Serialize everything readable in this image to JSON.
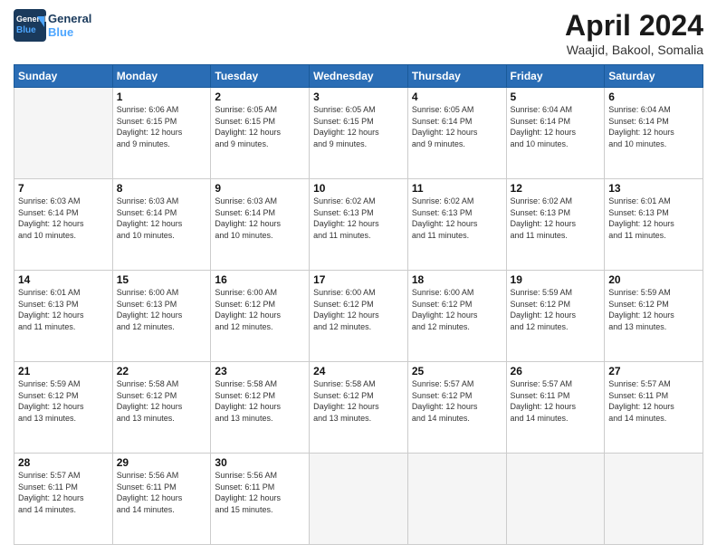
{
  "header": {
    "logo_line1": "General",
    "logo_line2": "Blue",
    "month_title": "April 2024",
    "location": "Waajid, Bakool, Somalia"
  },
  "weekdays": [
    "Sunday",
    "Monday",
    "Tuesday",
    "Wednesday",
    "Thursday",
    "Friday",
    "Saturday"
  ],
  "weeks": [
    [
      {
        "day": "",
        "info": ""
      },
      {
        "day": "1",
        "info": "Sunrise: 6:06 AM\nSunset: 6:15 PM\nDaylight: 12 hours\nand 9 minutes."
      },
      {
        "day": "2",
        "info": "Sunrise: 6:05 AM\nSunset: 6:15 PM\nDaylight: 12 hours\nand 9 minutes."
      },
      {
        "day": "3",
        "info": "Sunrise: 6:05 AM\nSunset: 6:15 PM\nDaylight: 12 hours\nand 9 minutes."
      },
      {
        "day": "4",
        "info": "Sunrise: 6:05 AM\nSunset: 6:14 PM\nDaylight: 12 hours\nand 9 minutes."
      },
      {
        "day": "5",
        "info": "Sunrise: 6:04 AM\nSunset: 6:14 PM\nDaylight: 12 hours\nand 10 minutes."
      },
      {
        "day": "6",
        "info": "Sunrise: 6:04 AM\nSunset: 6:14 PM\nDaylight: 12 hours\nand 10 minutes."
      }
    ],
    [
      {
        "day": "7",
        "info": "Sunrise: 6:03 AM\nSunset: 6:14 PM\nDaylight: 12 hours\nand 10 minutes."
      },
      {
        "day": "8",
        "info": "Sunrise: 6:03 AM\nSunset: 6:14 PM\nDaylight: 12 hours\nand 10 minutes."
      },
      {
        "day": "9",
        "info": "Sunrise: 6:03 AM\nSunset: 6:14 PM\nDaylight: 12 hours\nand 10 minutes."
      },
      {
        "day": "10",
        "info": "Sunrise: 6:02 AM\nSunset: 6:13 PM\nDaylight: 12 hours\nand 11 minutes."
      },
      {
        "day": "11",
        "info": "Sunrise: 6:02 AM\nSunset: 6:13 PM\nDaylight: 12 hours\nand 11 minutes."
      },
      {
        "day": "12",
        "info": "Sunrise: 6:02 AM\nSunset: 6:13 PM\nDaylight: 12 hours\nand 11 minutes."
      },
      {
        "day": "13",
        "info": "Sunrise: 6:01 AM\nSunset: 6:13 PM\nDaylight: 12 hours\nand 11 minutes."
      }
    ],
    [
      {
        "day": "14",
        "info": "Sunrise: 6:01 AM\nSunset: 6:13 PM\nDaylight: 12 hours\nand 11 minutes."
      },
      {
        "day": "15",
        "info": "Sunrise: 6:00 AM\nSunset: 6:13 PM\nDaylight: 12 hours\nand 12 minutes."
      },
      {
        "day": "16",
        "info": "Sunrise: 6:00 AM\nSunset: 6:12 PM\nDaylight: 12 hours\nand 12 minutes."
      },
      {
        "day": "17",
        "info": "Sunrise: 6:00 AM\nSunset: 6:12 PM\nDaylight: 12 hours\nand 12 minutes."
      },
      {
        "day": "18",
        "info": "Sunrise: 6:00 AM\nSunset: 6:12 PM\nDaylight: 12 hours\nand 12 minutes."
      },
      {
        "day": "19",
        "info": "Sunrise: 5:59 AM\nSunset: 6:12 PM\nDaylight: 12 hours\nand 12 minutes."
      },
      {
        "day": "20",
        "info": "Sunrise: 5:59 AM\nSunset: 6:12 PM\nDaylight: 12 hours\nand 13 minutes."
      }
    ],
    [
      {
        "day": "21",
        "info": "Sunrise: 5:59 AM\nSunset: 6:12 PM\nDaylight: 12 hours\nand 13 minutes."
      },
      {
        "day": "22",
        "info": "Sunrise: 5:58 AM\nSunset: 6:12 PM\nDaylight: 12 hours\nand 13 minutes."
      },
      {
        "day": "23",
        "info": "Sunrise: 5:58 AM\nSunset: 6:12 PM\nDaylight: 12 hours\nand 13 minutes."
      },
      {
        "day": "24",
        "info": "Sunrise: 5:58 AM\nSunset: 6:12 PM\nDaylight: 12 hours\nand 13 minutes."
      },
      {
        "day": "25",
        "info": "Sunrise: 5:57 AM\nSunset: 6:12 PM\nDaylight: 12 hours\nand 14 minutes."
      },
      {
        "day": "26",
        "info": "Sunrise: 5:57 AM\nSunset: 6:11 PM\nDaylight: 12 hours\nand 14 minutes."
      },
      {
        "day": "27",
        "info": "Sunrise: 5:57 AM\nSunset: 6:11 PM\nDaylight: 12 hours\nand 14 minutes."
      }
    ],
    [
      {
        "day": "28",
        "info": "Sunrise: 5:57 AM\nSunset: 6:11 PM\nDaylight: 12 hours\nand 14 minutes."
      },
      {
        "day": "29",
        "info": "Sunrise: 5:56 AM\nSunset: 6:11 PM\nDaylight: 12 hours\nand 14 minutes."
      },
      {
        "day": "30",
        "info": "Sunrise: 5:56 AM\nSunset: 6:11 PM\nDaylight: 12 hours\nand 15 minutes."
      },
      {
        "day": "",
        "info": ""
      },
      {
        "day": "",
        "info": ""
      },
      {
        "day": "",
        "info": ""
      },
      {
        "day": "",
        "info": ""
      }
    ]
  ]
}
